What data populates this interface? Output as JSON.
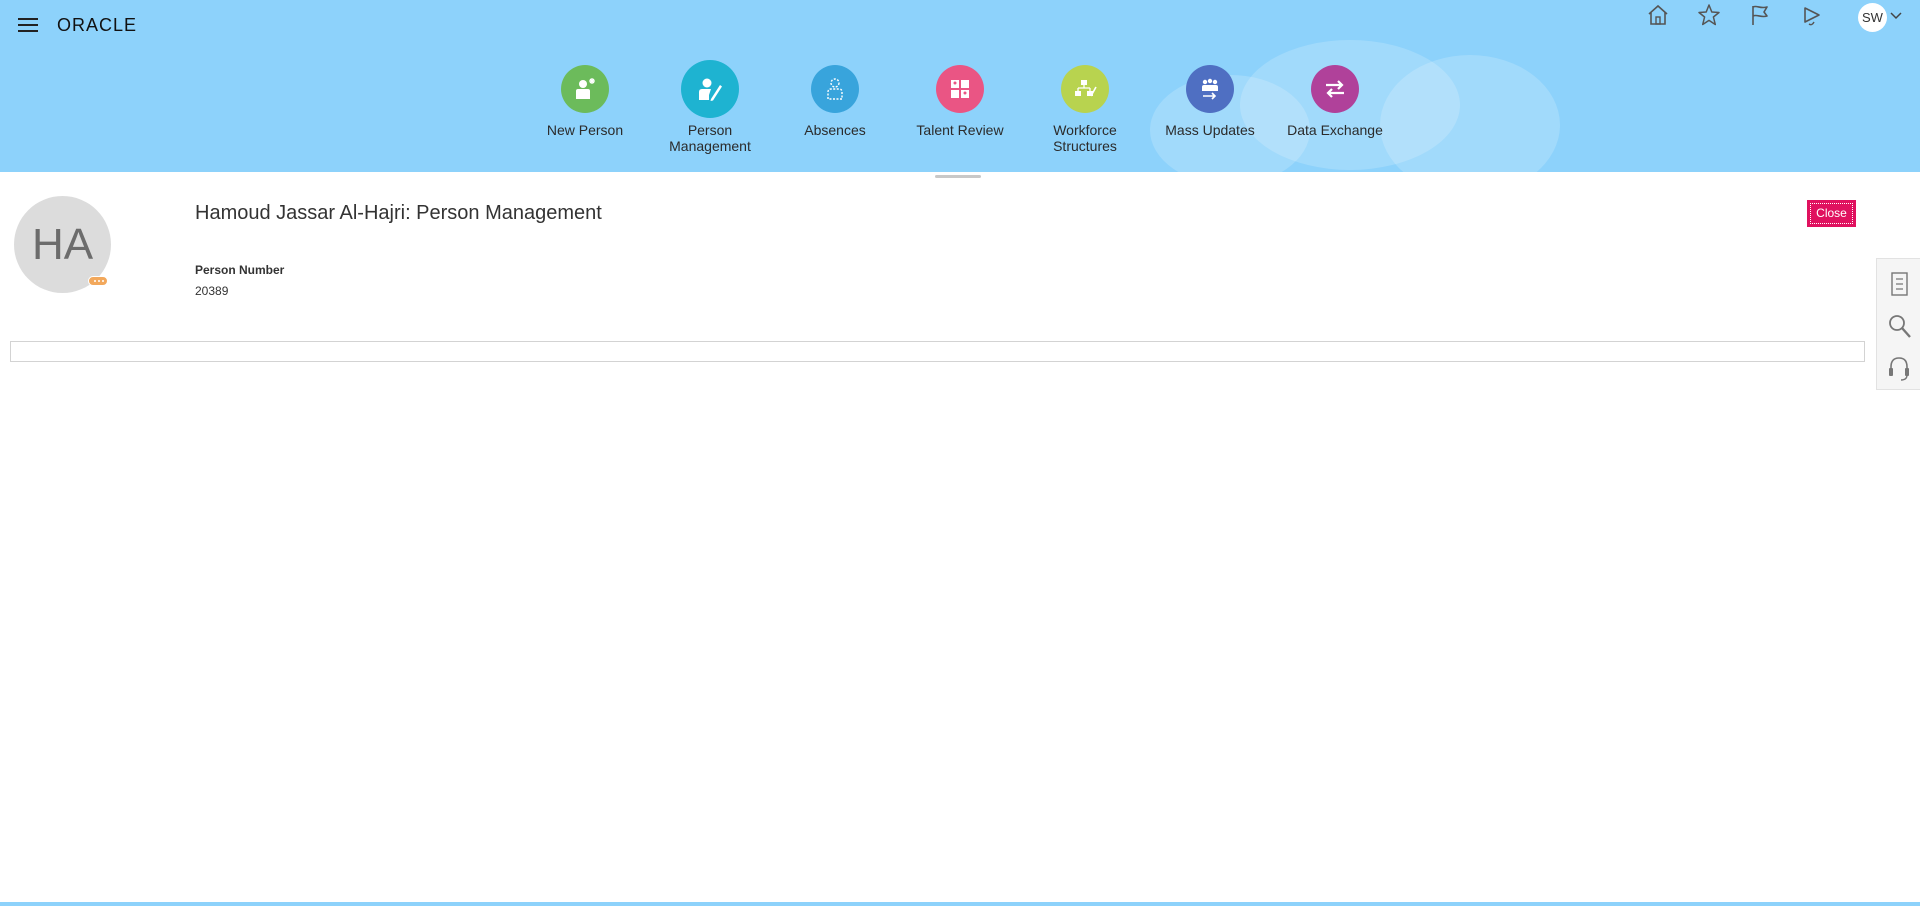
{
  "brand": {
    "logo_text": "ORACLE"
  },
  "header": {
    "user_initials": "SW",
    "icons": [
      "home-icon",
      "favorites-star-icon",
      "watchlist-flag-icon",
      "notifications-bell-icon"
    ]
  },
  "apps": [
    {
      "label": "New Person",
      "color": "#6cbb5b",
      "icon": "new-person-icon"
    },
    {
      "label": "Person\nManagement",
      "color": "#1eb3d1",
      "icon": "person-management-icon"
    },
    {
      "label": "Absences",
      "color": "#38a4dc",
      "icon": "absences-icon"
    },
    {
      "label": "Talent Review",
      "color": "#ea5584",
      "icon": "talent-review-icon"
    },
    {
      "label": "Workforce\nStructures",
      "color": "#b8d34f",
      "icon": "workforce-structures-icon"
    },
    {
      "label": "Mass Updates",
      "color": "#4f6fc2",
      "icon": "mass-updates-icon"
    },
    {
      "label": "Data Exchange",
      "color": "#b0419a",
      "icon": "data-exchange-icon"
    }
  ],
  "person": {
    "initials": "HA",
    "title": "Hamoud Jassar Al-Hajri: Person Management",
    "person_number_label": "Person Number",
    "person_number": "20389"
  },
  "actions": {
    "close_label": "Close"
  },
  "side_panel": [
    "tasks-list-icon",
    "search-icon",
    "help-headset-icon"
  ],
  "colors": {
    "header_bg": "#8dd2fb",
    "close_btn": "#e0115f"
  }
}
